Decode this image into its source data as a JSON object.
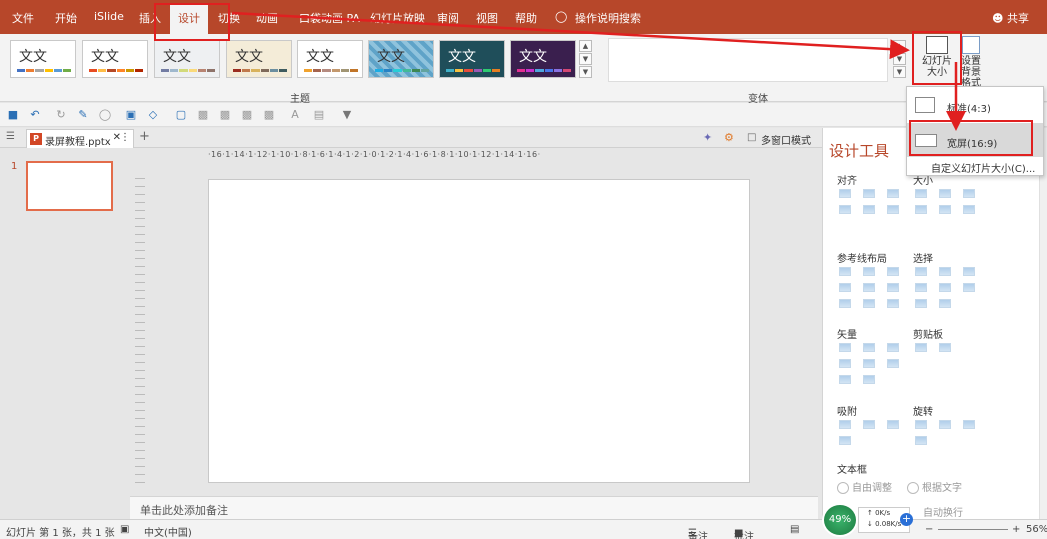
{
  "menu": {
    "items": [
      "文件",
      "开始",
      "iSlide",
      "插入",
      "设计",
      "切换",
      "动画",
      "口袋动画 PA",
      "幻灯片放映",
      "审阅",
      "视图",
      "帮助"
    ],
    "tell_me": "操作说明搜索",
    "share": "共享"
  },
  "ribbon": {
    "theme_sample": "文文",
    "themes_group": "主题",
    "variants_group": "变体",
    "slide_size_label": "幻灯片大小",
    "format_bg_label": "设置背景格式"
  },
  "doc": {
    "tab_name": "录屏教程.pptx",
    "multi_window": "多窗口模式"
  },
  "thumbnails": {
    "current_number": "1"
  },
  "ruler": {
    "h_labels": "·16·1·14·1·12·1·10·1·8·1·6·1·4·1·2·1·0·1·2·1·4·1·6·1·8·1·10·1·12·1·14·1·16·"
  },
  "notes": {
    "placeholder": "单击此处添加备注"
  },
  "design_pane": {
    "title": "设计工具",
    "sections": {
      "align": "对齐",
      "size": "大小",
      "guides": "参考线布局",
      "select": "选择",
      "vector": "矢量",
      "clipboard": "剪贴板",
      "snap": "吸附",
      "rotate": "旋转",
      "textbox": "文本框"
    },
    "radio_auto_adjust": "自由调整",
    "radio_fit_text": "根据文字",
    "check_autowrap": "自动换行"
  },
  "slide_size_menu": {
    "standard": "标准(4:3)",
    "widescreen": "宽屏(16:9)",
    "custom": "自定义幻灯片大小(C)..."
  },
  "statusbar": {
    "slide_info": "幻灯片 第 1 张，共 1 张",
    "language": "中文(中国)",
    "notes_btn": "备注",
    "comments_btn": "批注",
    "zoom": "56%"
  },
  "net_monitor": {
    "percent": "49%",
    "up": "0K/s",
    "down": "0.08K/s"
  },
  "colors": {
    "accent": "#b7472a",
    "annotation_red": "#e02020"
  }
}
